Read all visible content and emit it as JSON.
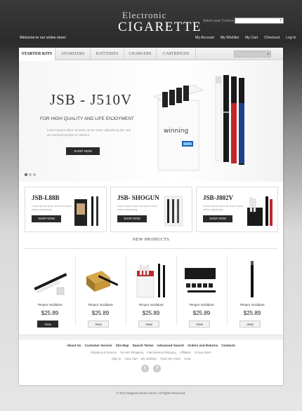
{
  "header": {
    "logo_line1": "Electronic",
    "logo_line2": "CIGARETTE",
    "currency_label": "Select your Currency:",
    "currency_value": "",
    "welcome": "Welcome to our online store!",
    "links": [
      "My Account",
      "My Wishlist",
      "My Cart",
      "Checkout",
      "Log In"
    ]
  },
  "nav": {
    "tabs": [
      "STARTER KITS",
      "ATOMIZERS",
      "BATTERIES",
      "CHARGERS",
      "CARTRIDGES"
    ]
  },
  "hero": {
    "title": "JSB - J510V",
    "subtitle": "FOR HIGH QUALITY AND LIFE ENJOYMENT",
    "text": "Lorem ipsum dolor sit amet conse ctetur adipisicing elit, sed do eiusmod tempor in cididunt.",
    "button": "SHOP NOW",
    "box_brand": "winning",
    "slide_count": 3,
    "active_slide": 1
  },
  "featured": [
    {
      "title": "JSB-L88B",
      "text": "Lorem ipsum dolor sit amet conse ctetur adipisicing",
      "button": "SHOP NOW"
    },
    {
      "title": "JSB- SHOGUN",
      "text": "Lorem ipsum dolor sit amet conse ctetur adipisicing",
      "button": "SHOP NOW"
    },
    {
      "title": "JSB-J802V",
      "text": "Lorem ipsum dolor sit amet conse ctetur adipisicing",
      "button": "SHOP NOW"
    }
  ],
  "new_products": {
    "title": "NEW PRODUCTS",
    "items": [
      {
        "name": "Tempor incididunt",
        "price": "$25.89",
        "button": "View"
      },
      {
        "name": "Tempor incididunt",
        "price": "$25.89",
        "button": "View"
      },
      {
        "name": "Tempor incididunt",
        "price": "$25.89",
        "button": "View"
      },
      {
        "name": "Tempor incididunt",
        "price": "$25.89",
        "button": "View"
      },
      {
        "name": "Tempor incididunt",
        "price": "$25.89",
        "button": "View"
      }
    ]
  },
  "footer": {
    "links_main": [
      "About Us",
      "Customer Service",
      "Site Map",
      "Search Terms",
      "Advanced Search",
      "Orders and Returns",
      "Contacts"
    ],
    "links_secondary": [
      "Shipping & Returns",
      "Secure Shopping",
      "International Shipping",
      "Affiliates",
      "Group Sales"
    ],
    "links_tertiary": [
      "Sign In",
      "View Cart",
      "My Wishlist",
      "Track My Order",
      "Help"
    ],
    "social": [
      "t",
      "f"
    ],
    "copyright": "© 2013 Magento Demo Store. All Rights Reserved."
  },
  "colors": {
    "dark_button": "#2a2a2a",
    "panel_bg": "#ffffff",
    "accent_red": "#c0282d",
    "accent_blue": "#1f3f8a"
  }
}
